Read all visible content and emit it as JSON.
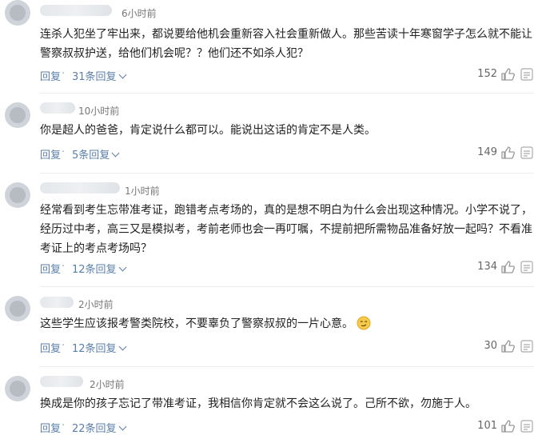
{
  "comments": [
    {
      "time": "6小时前",
      "lines": [
        "连杀人犯坐了牢出来，都说要给他机会重新容入社会重新做人。那些苦读十年寒窗学子怎么就不能让",
        "警察叔叔护送，给他们机会呢？？他们还不如杀人犯？"
      ],
      "reply_label": "回复",
      "sep": "·",
      "replies_label": "31条回复",
      "likes": "152"
    },
    {
      "time": "10小时前",
      "lines": [
        "你是超人的爸爸，肯定说什么都可以。能说出这话的肯定不是人类。"
      ],
      "reply_label": "回复",
      "sep": "·",
      "replies_label": "5条回复",
      "likes": "149"
    },
    {
      "time": "1小时前",
      "lines": [
        "经常看到考生忘带准考证，跑错考点考场的，真的是想不明白为什么会出现这种情况。小学不说了，",
        "经历过中考，高三又是模拟考，考前老师也会一再叮嘱，不提前把所需物品准备好放一起吗？不看准",
        "考证上的考点考场吗？"
      ],
      "reply_label": "回复",
      "sep": "·",
      "replies_label": "12条回复",
      "likes": "134"
    },
    {
      "time": "2小时前",
      "lines": [
        "这些学生应该报考警类院校，不要辜负了警察叔叔的一片心意。"
      ],
      "emoji": "smirk-emoji",
      "reply_label": "回复",
      "sep": "·",
      "replies_label": "12条回复",
      "likes": "30"
    },
    {
      "time": "2小时前",
      "lines": [
        "换成是你的孩子忘记了带准考证，我相信你肯定就不会这么说了。己所不欲，勿施于人。"
      ],
      "reply_label": "回复",
      "sep": "·",
      "replies_label": "22条回复",
      "likes": "101"
    }
  ],
  "icons": {
    "like": "thumbs-up-icon",
    "more": "more-options-icon",
    "expand": "chevron-down-icon"
  },
  "colors": {
    "link": "#5a7fa8",
    "text": "#222222",
    "meta": "#777777"
  }
}
